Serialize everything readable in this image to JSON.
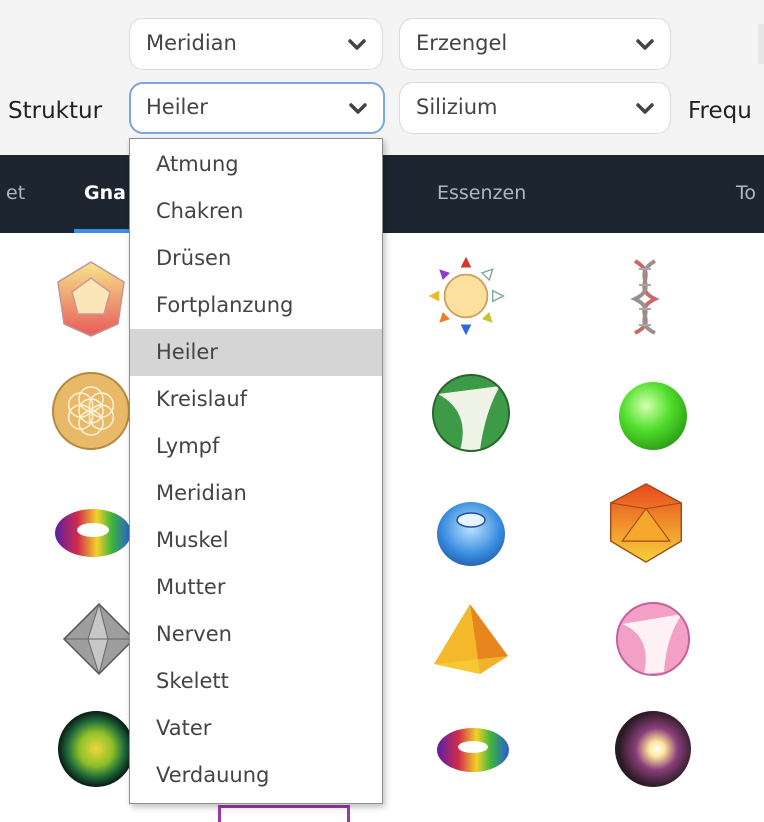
{
  "filters": {
    "struktur_label": "Struktur",
    "freq_label": "Frequ",
    "top_left_value": "Meridian",
    "top_right_value": "Erzengel",
    "struktur_value": "Heiler",
    "material_value": "Silizium"
  },
  "nav": {
    "tabs": [
      "et",
      "Gna",
      "Essenzen",
      "To"
    ],
    "active_index": 1
  },
  "dropdown": {
    "options": [
      "Atmung",
      "Chakren",
      "Drüsen",
      "Fortplanzung",
      "Heiler",
      "Kreislauf",
      "Lympf",
      "Meridian",
      "Muskel",
      "Mutter",
      "Nerven",
      "Skelett",
      "Vater",
      "Verdauung"
    ],
    "selected": "Heiler"
  },
  "grid_icons": [
    "dodecahedron-icon",
    "sun-rays-icon",
    "dna-helix-icon",
    "flower-of-life-icon",
    "striped-sphere-green-icon",
    "green-sphere-icon",
    "rainbow-torus-icon",
    "blue-geode-icon",
    "icosahedron-icon",
    "octahedron-icon",
    "pyramid-icon",
    "striped-sphere-pink-icon",
    "dark-aura-sphere-icon",
    "rainbow-torus-icon",
    "purple-glow-sphere-icon"
  ]
}
